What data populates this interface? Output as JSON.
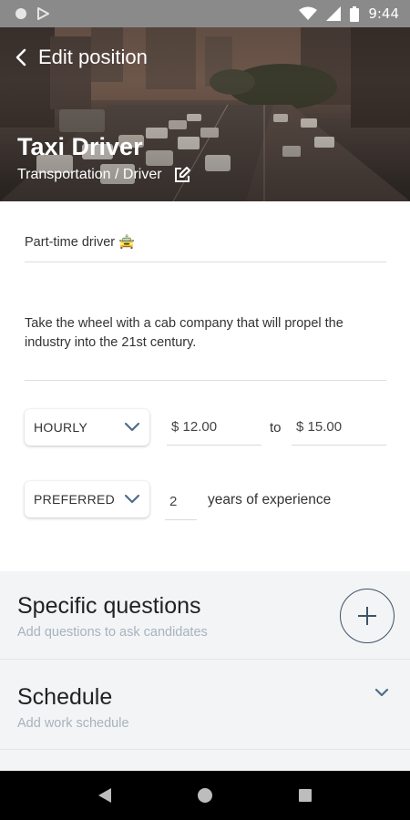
{
  "status_bar": {
    "time": "9:44",
    "icons": [
      "circle-notification-icon",
      "play-store-icon",
      "wifi-icon",
      "signal-icon",
      "battery-icon"
    ]
  },
  "header": {
    "back_label": "Edit position",
    "job_title": "Taxi Driver",
    "category": "Transportation / Driver"
  },
  "form": {
    "position_name": "Part-time driver 🚖",
    "description": "Take the wheel with a cab company that will propel the industry into the 21st century.",
    "pay_type": "HOURLY",
    "pay_min": "$ 12.00",
    "pay_to_label": "to",
    "pay_max": "$ 15.00",
    "experience_requirement": "PREFERRED",
    "experience_years": "2",
    "experience_label": "years of experience"
  },
  "sections": [
    {
      "title": "Specific questions",
      "subtitle": "Add questions to ask candidates",
      "action": "add"
    },
    {
      "title": "Schedule",
      "subtitle": "Add work schedule",
      "action": "expand"
    }
  ],
  "nav": {
    "buttons": [
      "back-nav",
      "home-nav",
      "recents-nav"
    ]
  },
  "colors": {
    "accent": "#3d5368",
    "section_bg": "#f3f4f5",
    "subtitle": "#a8b3be"
  }
}
